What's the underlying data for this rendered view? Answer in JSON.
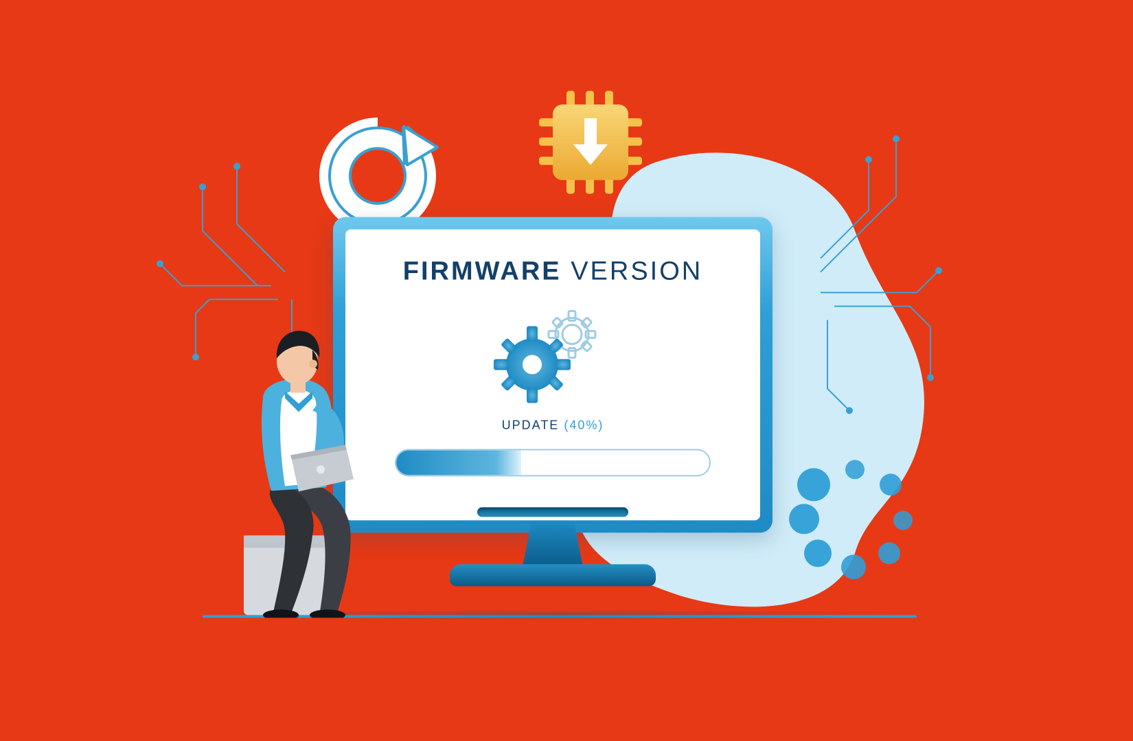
{
  "screen": {
    "title_bold": "FIRMWARE",
    "title_light": "VERSION",
    "update_label": "UPDATE",
    "update_percent_text": "(40%)",
    "progress_percent": 40
  },
  "icons": {
    "refresh": "refresh-arrow",
    "chip": "microchip-download",
    "gears": "settings-gears",
    "loading": "loading-dots"
  },
  "colors": {
    "background": "#e73915",
    "monitor_blue": "#2f9fd6",
    "dark_blue": "#12406a",
    "chip_yellow": "#f4c24a"
  }
}
